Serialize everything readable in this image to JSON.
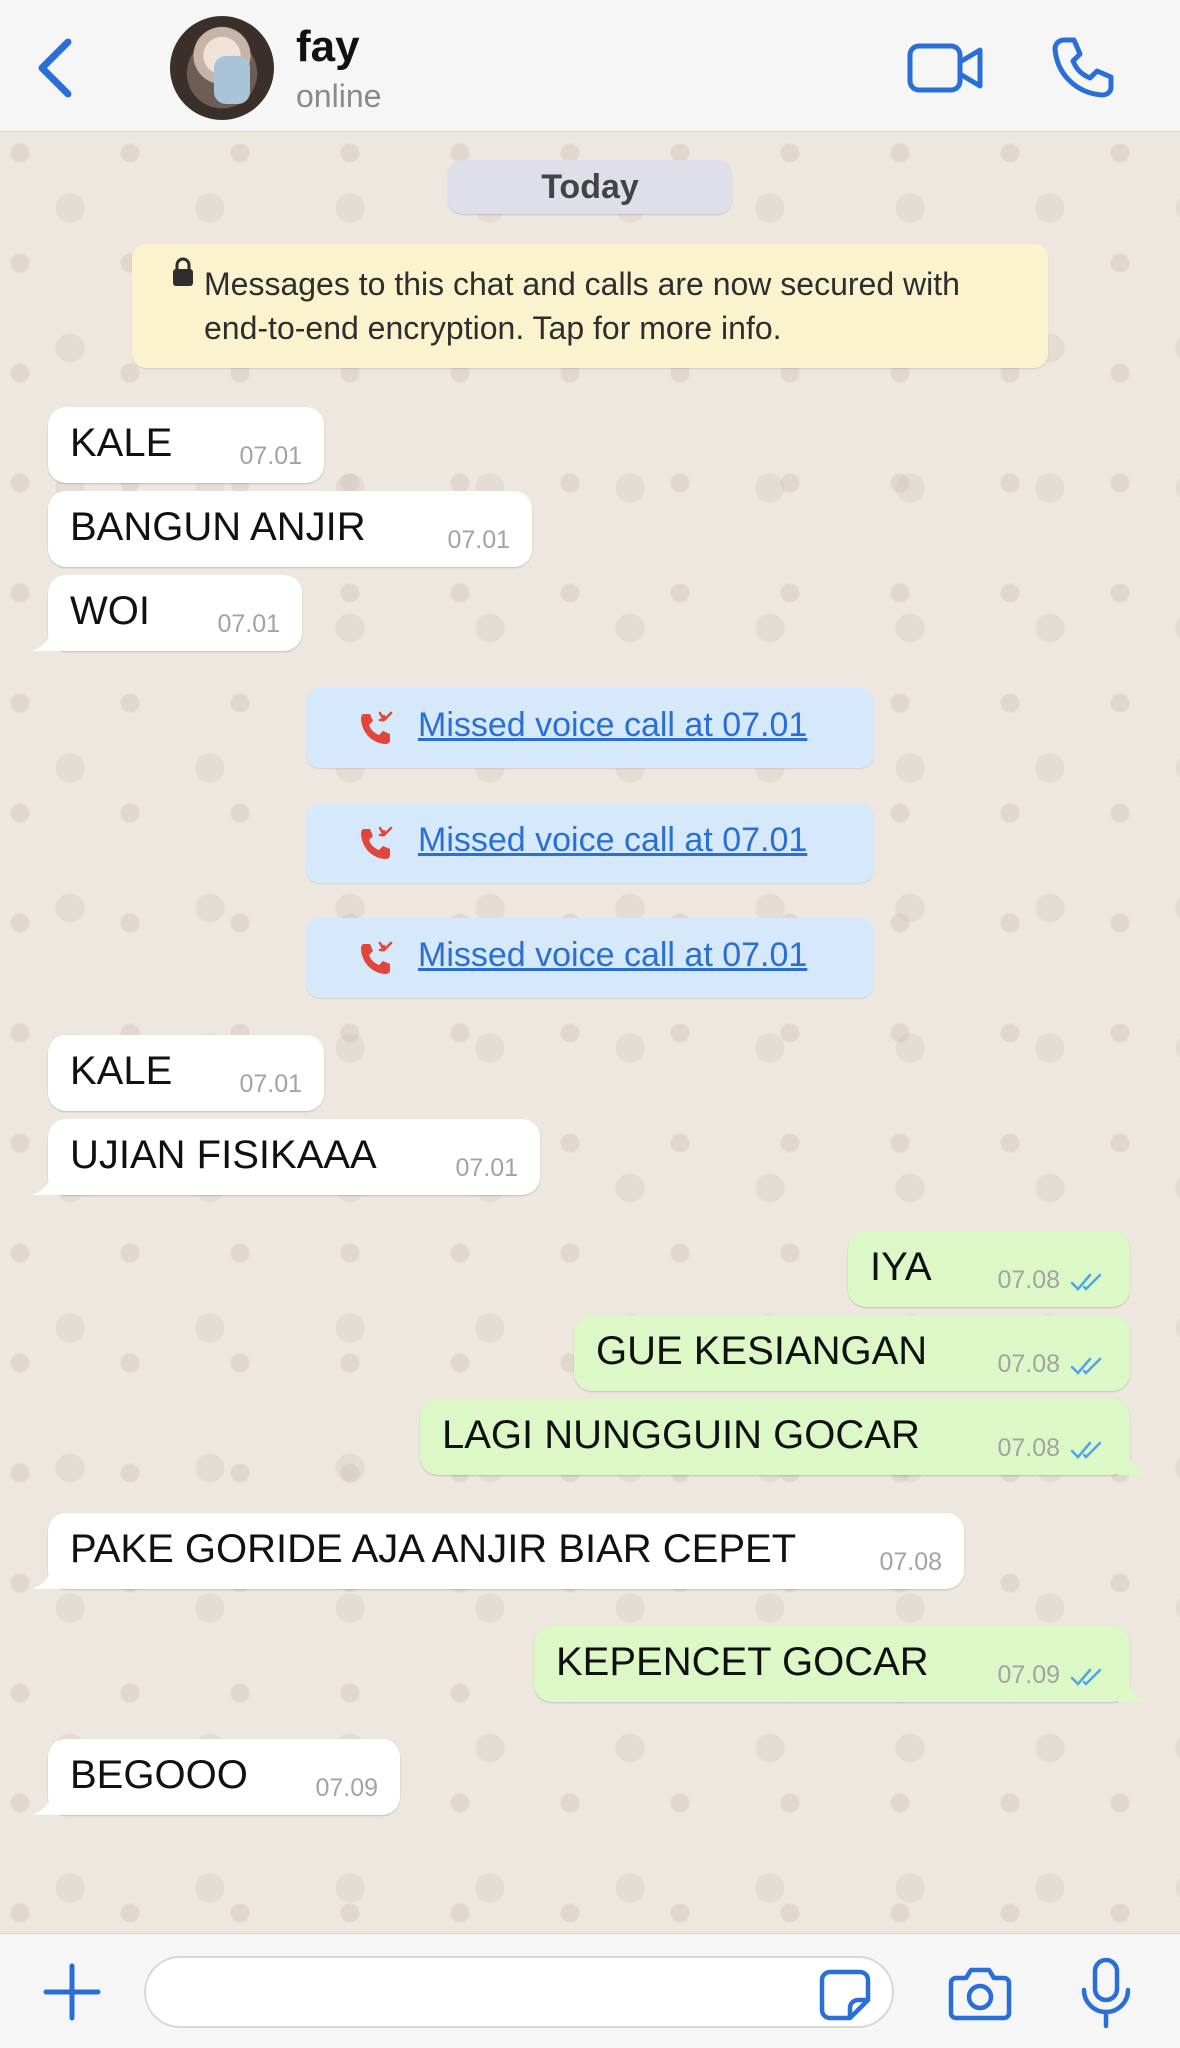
{
  "header": {
    "contact_name": "fay",
    "contact_status": "online"
  },
  "chat": {
    "date_label": "Today",
    "encryption_notice": "Messages to this chat and calls are now secured with end-to-end encryption. Tap for more info.",
    "messages": [
      {
        "text": "KALE",
        "time": "07.01",
        "dir": "in"
      },
      {
        "text": "BANGUN ANJIR",
        "time": "07.01",
        "dir": "in"
      },
      {
        "text": "WOI",
        "time": "07.01",
        "dir": "in"
      },
      {
        "text": "Missed voice call at 07.01",
        "type": "missed-call"
      },
      {
        "text": "Missed voice call at 07.01",
        "type": "missed-call"
      },
      {
        "text": "Missed voice call at 07.01",
        "type": "missed-call"
      },
      {
        "text": "KALE",
        "time": "07.01",
        "dir": "in"
      },
      {
        "text": "UJIAN FISIKAAA",
        "time": "07.01",
        "dir": "in"
      },
      {
        "text": "IYA",
        "time": "07.08",
        "dir": "out",
        "status": "read"
      },
      {
        "text": "GUE KESIANGAN",
        "time": "07.08",
        "dir": "out",
        "status": "read"
      },
      {
        "text": "LAGI NUNGGUIN GOCAR",
        "time": "07.08",
        "dir": "out",
        "status": "read"
      },
      {
        "text": "PAKE GORIDE AJA ANJIR BIAR CEPET",
        "time": "07.08",
        "dir": "in"
      },
      {
        "text": "KEPENCET GOCAR",
        "time": "07.09",
        "dir": "out",
        "status": "read"
      },
      {
        "text": "BEGOOO",
        "time": "07.09",
        "dir": "in"
      }
    ]
  },
  "input": {
    "placeholder": ""
  },
  "colors": {
    "accent": "#2a6fd8",
    "incoming_bubble": "#ffffff",
    "outgoing_bubble": "#dcf8c6",
    "missed_call_bg": "#d5e9fa",
    "missed_call_icon": "#e0463b",
    "encryption_bg": "#fbf3cd",
    "read_ticks": "#4fa6e8"
  },
  "icons": [
    "chevron-left-icon",
    "video-camera-icon",
    "phone-icon",
    "lock-icon",
    "missed-call-icon",
    "double-check-icon",
    "plus-icon",
    "sticker-icon",
    "camera-icon",
    "microphone-icon"
  ]
}
